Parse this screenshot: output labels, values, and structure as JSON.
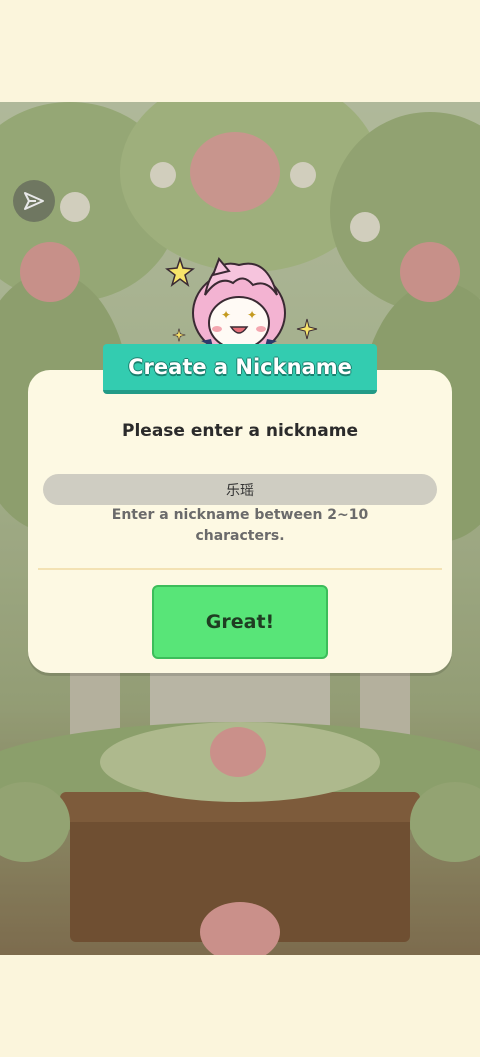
{
  "dialog": {
    "title": "Create a Nickname",
    "prompt": "Please enter a nickname",
    "input_value": "乐瑶",
    "hint": "Enter a nickname between 2~10 characters.",
    "confirm_label": "Great!"
  },
  "icons": {
    "share": "share-icon",
    "mascot": "mascot-character-icon"
  },
  "colors": {
    "title_banner": "#33ccb0",
    "confirm_button": "#58e578",
    "dialog_background": "#fdf9e3",
    "input_background": "#cfcdc2"
  }
}
